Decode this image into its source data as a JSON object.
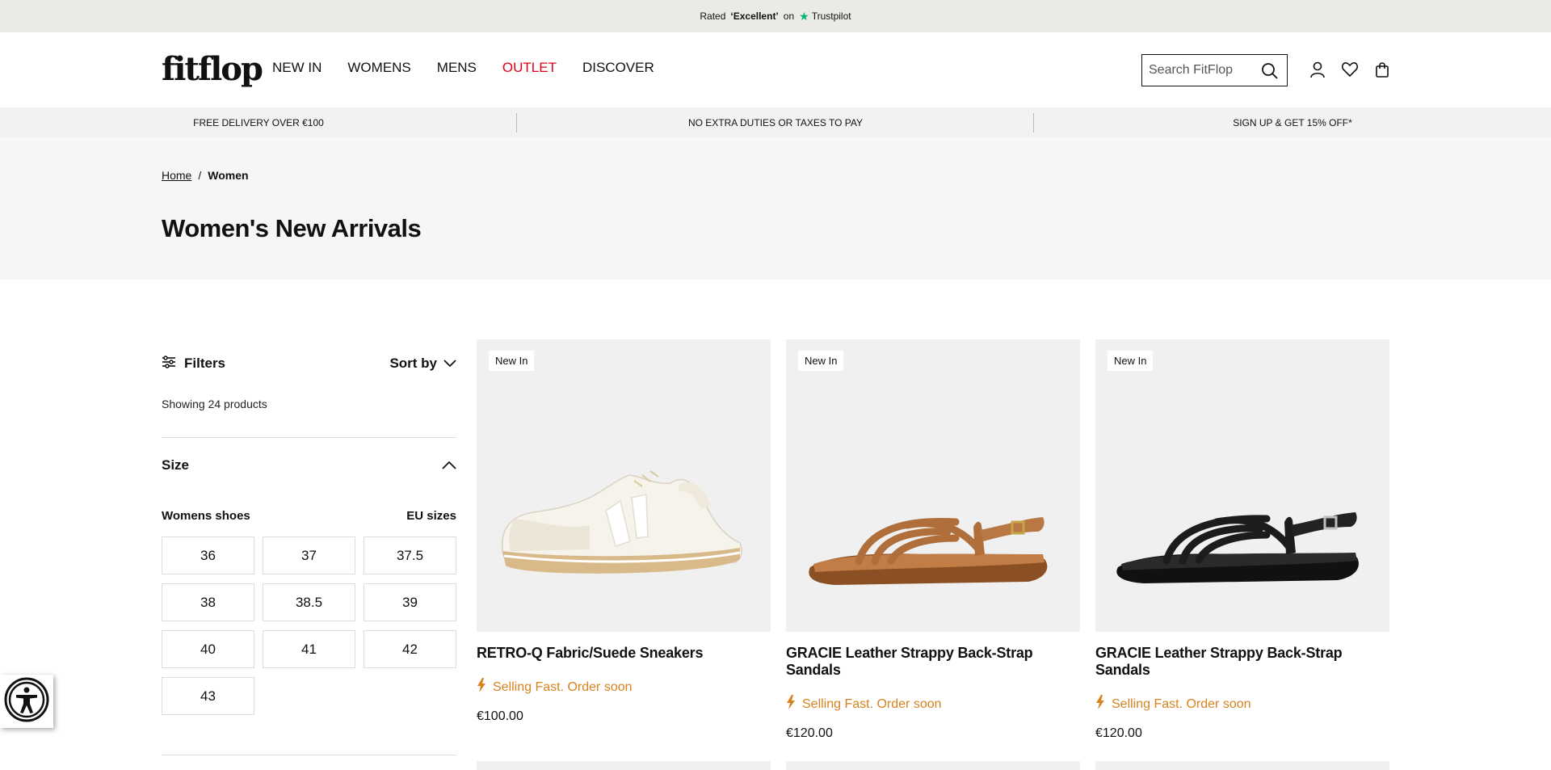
{
  "topbar": {
    "rated": "Rated",
    "rating": "‘Excellent’",
    "on": "on",
    "provider": "Trustpilot"
  },
  "header": {
    "logo": "fitflop",
    "nav": [
      "NEW IN",
      "WOMENS",
      "MENS",
      "OUTLET",
      "DISCOVER"
    ],
    "search_placeholder": "Search FitFlop",
    "accent_outlet": "#e3001b"
  },
  "usp": [
    "FREE DELIVERY OVER €100",
    "NO EXTRA DUTIES OR TAXES TO PAY",
    "SIGN UP & GET 15% OFF*"
  ],
  "breadcrumb": {
    "home": "Home",
    "separator": "/",
    "current": "Women"
  },
  "page_title": "Women's New Arrivals",
  "sidebar": {
    "filters_label": "Filters",
    "sort_label": "Sort by",
    "showing": "Showing 24 products",
    "size_label": "Size",
    "size_group": "Womens shoes",
    "size_system": "EU sizes",
    "sizes": [
      "36",
      "37",
      "37.5",
      "38",
      "38.5",
      "39",
      "40",
      "41",
      "42",
      "43"
    ]
  },
  "products": [
    {
      "badge": "New In",
      "name": "RETRO-Q Fabric/Suede Sneakers",
      "status": "Selling Fast. Order soon",
      "price": "€100.00"
    },
    {
      "badge": "New In",
      "name": "GRACIE Leather Strappy Back-Strap Sandals",
      "status": "Selling Fast. Order soon",
      "price": "€120.00"
    },
    {
      "badge": "New In",
      "name": "GRACIE Leather Strappy Back-Strap Sandals",
      "status": "Selling Fast. Order soon",
      "price": "€120.00"
    }
  ],
  "colors": {
    "status": "#d7831f",
    "trustpilot": "#00b67a"
  }
}
